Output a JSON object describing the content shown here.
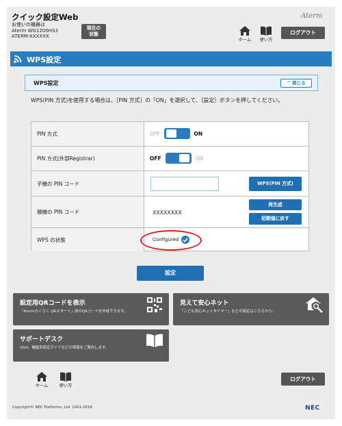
{
  "header": {
    "title": "クイック設定Web",
    "info_line1": "お使いの機器は",
    "info_line2": "Aterm WG1200HS3",
    "info_line3": "ATERM-XXXXXX",
    "status_button": "現在の状態",
    "brand": "Aterm",
    "home_label": "ホーム",
    "manual_label": "使い方",
    "logout_label": "ログアウト"
  },
  "banner": {
    "title": "WPS設定"
  },
  "panel": {
    "title": "WPS設定",
    "close_label": "閉じる",
    "description": "WPS(PIN 方式)を使用する場合は、［PIN 方式］の「ON」を選択して、［設定］ボタンを押してください。"
  },
  "table": {
    "pin_method": {
      "label": "PIN 方式",
      "off": "OFF",
      "on": "ON",
      "state": "ON"
    },
    "pin_external": {
      "label": "PIN 方式(外部Registrar)",
      "off": "OFF",
      "on": "ON",
      "state": "OFF"
    },
    "child_pin": {
      "label": "子機の PIN コード",
      "value": "",
      "button": "WPS(PIN 方式)"
    },
    "parent_pin": {
      "label": "親機の PIN コード",
      "value": "XXXXXXXX",
      "regen_button": "再生成",
      "reset_button": "初期値に戻す"
    },
    "wps_status": {
      "label": "WPS の状態",
      "value": "Configured"
    }
  },
  "setting_button": "設定",
  "cards": [
    {
      "title": "設定用QRコードを表示",
      "desc": "「Atermらくらく QRスタート」用のQRコードを作成できます。",
      "icon": "qr-code-icon"
    },
    {
      "title": "見えて安心ネット",
      "desc": "「こども安心ネットタイマー」などの設定はこちらから。",
      "icon": "house-search-icon"
    },
    {
      "title": "サポートデスク",
      "desc": "Q&A、機能別設定ガイドなどの情報をご案内します。",
      "icon": "book-icon"
    }
  ],
  "footer": {
    "home_label": "ホーム",
    "manual_label": "使い方",
    "logout_label": "ログアウト",
    "copyright": "Copyright© NEC Platforms, Ltd. 2001-2018",
    "nec": "NEC"
  },
  "colors": {
    "accent": "#2a7cc0",
    "button_dark": "#555555",
    "highlight": "#e02020"
  }
}
